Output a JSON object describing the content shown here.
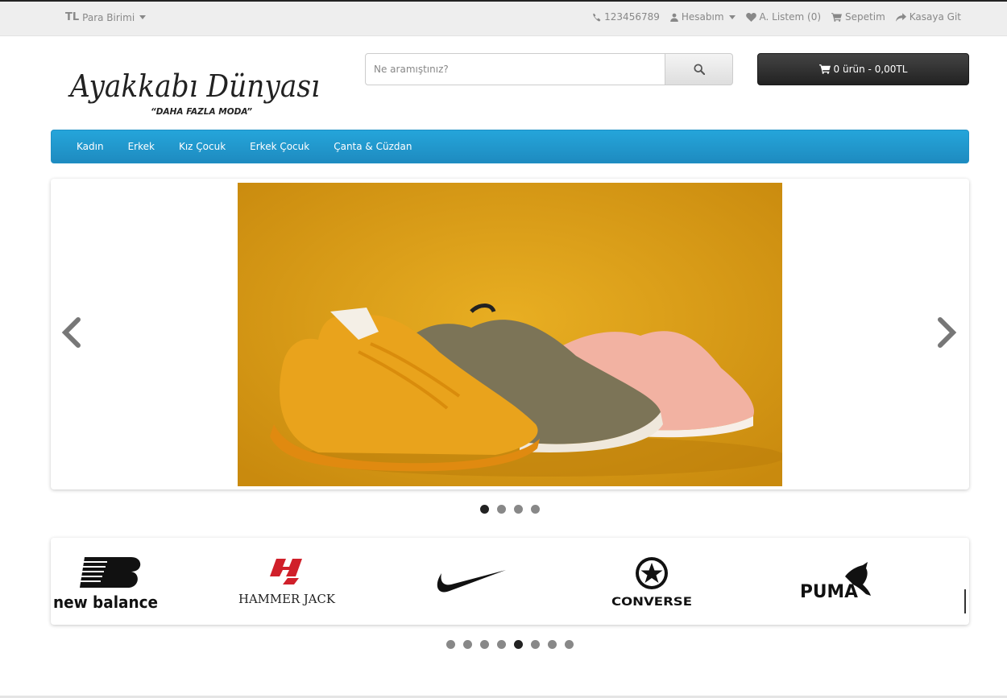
{
  "topbar": {
    "currency_symbol": "TL",
    "currency_label": "Para Birimi",
    "phone": "123456789",
    "account": "Hesabım",
    "wishlist": "A. Listem (0)",
    "cart": "Sepetim",
    "checkout": "Kasaya Git"
  },
  "header": {
    "logo_text": "Ayakkabı Dünyası",
    "logo_tagline": "“DAHA FAZLA MODA”",
    "search_placeholder": "Ne aramıştınız?",
    "cart_button": "0 ürün - 0,00TL"
  },
  "menu": {
    "items": [
      "Kadın",
      "Erkek",
      "Kız Çocuk",
      "Erkek Çocuk",
      "Çanta & Cüzdan"
    ]
  },
  "slider": {
    "slide_count": 4,
    "active_slide": 1
  },
  "brands": {
    "items": [
      {
        "name": "new balance",
        "icon": "new-balance-logo"
      },
      {
        "name": "HAMMER JACK",
        "icon": "hammer-jack-logo"
      },
      {
        "name": "nike",
        "icon": "nike-swoosh-logo"
      },
      {
        "name": "CONVERSE",
        "icon": "converse-star-logo"
      },
      {
        "name": "PUMA",
        "icon": "puma-cat-logo"
      }
    ],
    "page_count": 8,
    "active_page": 5
  },
  "colors": {
    "menu_blue": "#229ACF",
    "cart_dark": "#333333",
    "slide_bg": "#E2A516"
  }
}
